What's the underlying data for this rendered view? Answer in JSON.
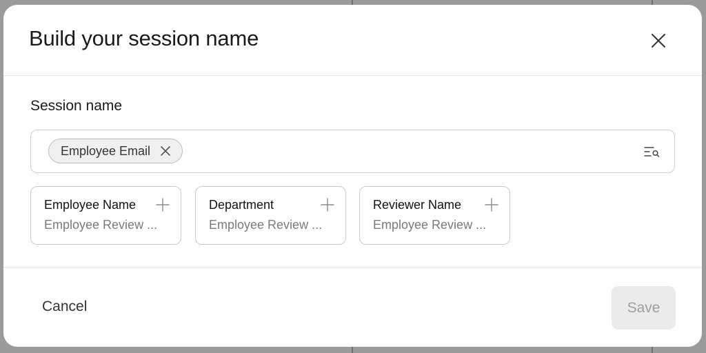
{
  "dialog": {
    "title": "Build your session name"
  },
  "session_field": {
    "label": "Session name",
    "tokens": [
      {
        "label": "Employee Email"
      }
    ]
  },
  "suggestions": [
    {
      "title": "Employee Name",
      "subtitle": "Employee Review ..."
    },
    {
      "title": "Department",
      "subtitle": "Employee Review ..."
    },
    {
      "title": "Reviewer Name",
      "subtitle": "Employee Review ..."
    }
  ],
  "footer": {
    "cancel_label": "Cancel",
    "save_label": "Save",
    "save_enabled": false
  },
  "icons": {
    "close": "close-icon",
    "chip_remove": "x-icon",
    "filter": "list-search-icon",
    "add": "plus-icon"
  },
  "colors": {
    "backdrop": "#9b9b9b",
    "surface": "#ffffff",
    "chip_bg": "#f0f0f0",
    "disabled_button_bg": "#ebebeb",
    "disabled_button_text": "#9e9e9e"
  }
}
